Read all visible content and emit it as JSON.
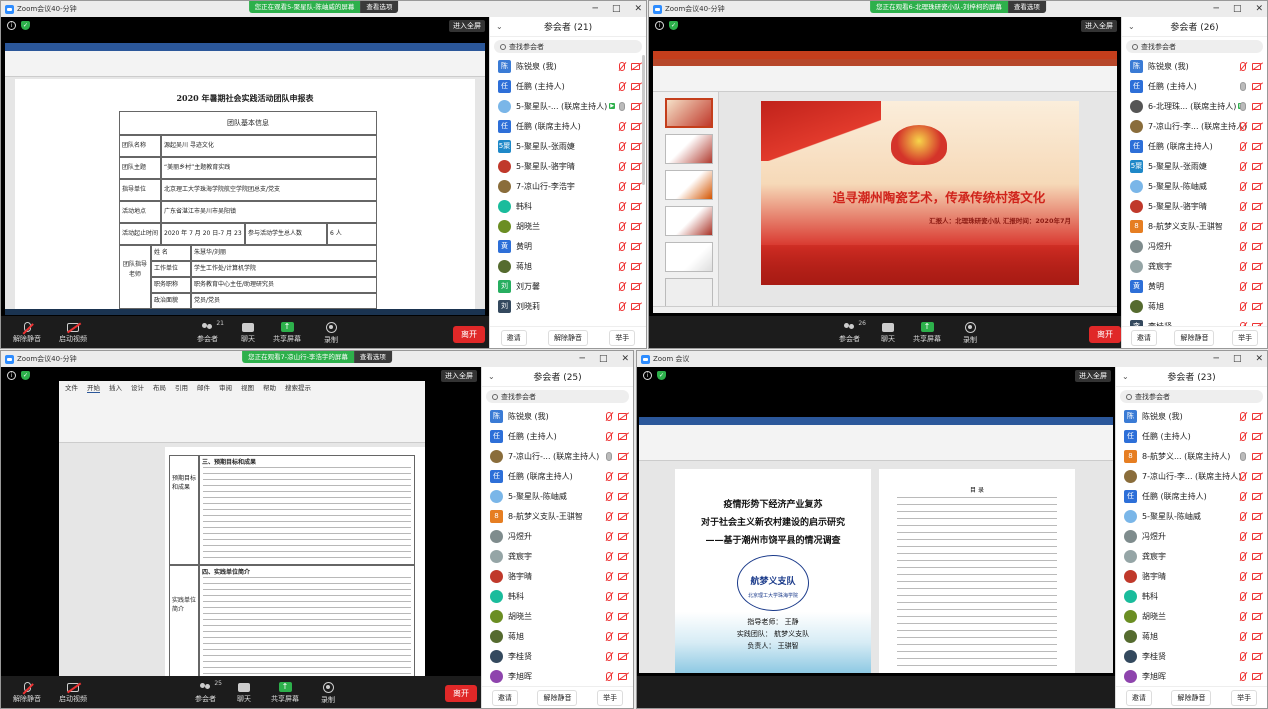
{
  "windows": [
    {
      "title": "Zoom会议40-分钟",
      "sharing_text": "您正在观看5-聚星队-陈岫威的屏幕",
      "view_options": "查看选项",
      "fullscreen": "进入全屏",
      "toolbar": {
        "unmute": "解除静音",
        "video": "启动视频",
        "participants": "参会者",
        "participants_count": "21",
        "chat": "聊天",
        "share": "共享屏幕",
        "record": "录制",
        "end": "离开"
      },
      "panel": {
        "title": "参会者 (21)",
        "search": "查找参会者",
        "footer": [
          "邀请",
          "解除静音",
          "举手"
        ],
        "participants": [
          {
            "name": "陈锐泉 (我)",
            "avatar": "陈",
            "color": "#3a7bd5",
            "mic": "off"
          },
          {
            "name": "任鹏 (主持人)",
            "avatar": "任",
            "color": "#2d6fd8",
            "mic": "off"
          },
          {
            "name": "5-聚星队-... (联席主持人)",
            "avatar": "",
            "color": "#7ab6e8",
            "mic": "on",
            "badge": "▶"
          },
          {
            "name": "任鹏 (联席主持人)",
            "avatar": "任",
            "color": "#2d6fd8",
            "mic": "off"
          },
          {
            "name": "5-聚星队-张雨婕",
            "avatar": "5聚",
            "color": "#1e88c8",
            "mic": "off"
          },
          {
            "name": "5-聚星队-骆宇晴",
            "avatar": "",
            "color": "#c0392b",
            "mic": "off"
          },
          {
            "name": "7-凉山行-李浩宇",
            "avatar": "",
            "color": "#8a6d3b",
            "mic": "off"
          },
          {
            "name": "韩科",
            "avatar": "",
            "color": "#1abc9c",
            "mic": "off"
          },
          {
            "name": "胡晓兰",
            "avatar": "",
            "color": "#6b8e23",
            "mic": "off"
          },
          {
            "name": "黄明",
            "avatar": "黄",
            "color": "#2d6fd8",
            "mic": "off"
          },
          {
            "name": "蒋旭",
            "avatar": "",
            "color": "#556b2f",
            "mic": "off"
          },
          {
            "name": "刘万馨",
            "avatar": "刘",
            "color": "#27ae60",
            "mic": "off"
          },
          {
            "name": "刘晓莉",
            "avatar": "刘",
            "color": "#34495e",
            "mic": "off"
          }
        ]
      },
      "doc": {
        "heading": "2020 年暑期社会实践活动团队申报表",
        "table_title": "团队基本信息",
        "rows": [
          [
            "团队名称",
            "源起吴川 寻迹文化"
          ],
          [
            "团队主题",
            "“美丽乡村”主题教育实践"
          ],
          [
            "指导单位",
            "北京理工大学珠海学院航空学院团总支/党支"
          ],
          [
            "活动地点",
            "广东省湛江市吴川市吴阳镇"
          ],
          [
            "活动起止时间",
            "2020 年 7 月 20 日-7 月 23 日",
            "参与活动学生总人数",
            "6 人"
          ]
        ],
        "sub_rows": [
          [
            "姓 名",
            "朱慧华/刘丽"
          ],
          [
            "工作单位",
            "学生工作处/计算机学院"
          ],
          [
            "职务职称",
            "职务教育中心主任/助理研究员"
          ],
          [
            "政治面貌",
            "党员/党员"
          ]
        ],
        "side_label": "团队指导老师"
      }
    },
    {
      "title": "Zoom会议40-分钟",
      "sharing_text": "您正在观看6-北理珠研瓷小队-刘梓柯的屏幕",
      "view_options": "查看选项",
      "fullscreen": "进入全屏",
      "toolbar": {
        "unmute": "解除静音",
        "video": "启动视频",
        "participants": "参会者",
        "participants_count": "26",
        "chat": "聊天",
        "share": "共享屏幕",
        "record": "录制",
        "end": "离开"
      },
      "panel": {
        "title": "参会者 (26)",
        "search": "查找参会者",
        "footer": [
          "邀请",
          "解除静音",
          "举手"
        ],
        "participants": [
          {
            "name": "陈锐泉 (我)",
            "avatar": "陈",
            "color": "#3a7bd5",
            "mic": "off"
          },
          {
            "name": "任鹏 (主持人)",
            "avatar": "任",
            "color": "#2d6fd8",
            "mic": "on"
          },
          {
            "name": "6-北理珠... (联席主持人)",
            "avatar": "",
            "color": "#555",
            "mic": "on",
            "badge": "▶"
          },
          {
            "name": "7-凉山行-李... (联席主持人)",
            "avatar": "",
            "color": "#8a6d3b",
            "mic": "off"
          },
          {
            "name": "任鹏 (联席主持人)",
            "avatar": "任",
            "color": "#2d6fd8",
            "mic": "off"
          },
          {
            "name": "5-聚星队-张雨婕",
            "avatar": "5聚",
            "color": "#1e88c8",
            "mic": "off"
          },
          {
            "name": "5-聚星队-陈岫威",
            "avatar": "",
            "color": "#7ab6e8",
            "mic": "off"
          },
          {
            "name": "5-聚星队-骆宇晴",
            "avatar": "",
            "color": "#c0392b",
            "mic": "off"
          },
          {
            "name": "8-航梦义支队-王骐智",
            "avatar": "8",
            "color": "#e67e22",
            "mic": "off"
          },
          {
            "name": "冯煜升",
            "avatar": "",
            "color": "#7f8c8d",
            "mic": "off"
          },
          {
            "name": "龚宸宇",
            "avatar": "",
            "color": "#95a5a6",
            "mic": "off"
          },
          {
            "name": "黄明",
            "avatar": "黄",
            "color": "#2d6fd8",
            "mic": "off"
          },
          {
            "name": "蒋旭",
            "avatar": "",
            "color": "#556b2f",
            "mic": "off"
          },
          {
            "name": "李桂贤",
            "avatar": "李",
            "color": "#34495e",
            "mic": "off"
          }
        ]
      },
      "ppt": {
        "title": "追寻潮州陶瓷艺术，传承传统村落文化",
        "subtitle": "汇报人：北理珠研瓷小队   汇报时间：2020年7月",
        "app_title": "北理珠.pptx - PowerPoint"
      }
    },
    {
      "title": "Zoom会议40-分钟",
      "sharing_text": "您正在观看7-凉山行-李浩宇的屏幕",
      "view_options": "查看选项",
      "fullscreen": "进入全屏",
      "toolbar": {
        "unmute": "解除静音",
        "video": "启动视频",
        "participants": "参会者",
        "participants_count": "25",
        "chat": "聊天",
        "share": "共享屏幕",
        "record": "录制",
        "end": "离开"
      },
      "panel": {
        "title": "参会者 (25)",
        "search": "查找参会者",
        "footer": [
          "邀请",
          "解除静音",
          "举手"
        ],
        "participants": [
          {
            "name": "陈锐泉 (我)",
            "avatar": "陈",
            "color": "#3a7bd5",
            "mic": "off"
          },
          {
            "name": "任鹏 (主持人)",
            "avatar": "任",
            "color": "#2d6fd8",
            "mic": "off"
          },
          {
            "name": "7-凉山行-... (联席主持人)",
            "avatar": "",
            "color": "#8a6d3b",
            "mic": "on"
          },
          {
            "name": "任鹏 (联席主持人)",
            "avatar": "任",
            "color": "#2d6fd8",
            "mic": "off"
          },
          {
            "name": "5-聚星队-陈岫威",
            "avatar": "",
            "color": "#7ab6e8",
            "mic": "off"
          },
          {
            "name": "8-航梦义支队-王骐智",
            "avatar": "8",
            "color": "#e67e22",
            "mic": "off"
          },
          {
            "name": "冯煜升",
            "avatar": "",
            "color": "#7f8c8d",
            "mic": "off"
          },
          {
            "name": "龚宸宇",
            "avatar": "",
            "color": "#95a5a6",
            "mic": "off"
          },
          {
            "name": "骆宇晴",
            "avatar": "",
            "color": "#c0392b",
            "mic": "off"
          },
          {
            "name": "韩科",
            "avatar": "",
            "color": "#1abc9c",
            "mic": "off"
          },
          {
            "name": "胡晓兰",
            "avatar": "",
            "color": "#6b8e23",
            "mic": "off"
          },
          {
            "name": "蒋旭",
            "avatar": "",
            "color": "#556b2f",
            "mic": "off"
          },
          {
            "name": "李桂贤",
            "avatar": "",
            "color": "#34495e",
            "mic": "off"
          },
          {
            "name": "李旭晖",
            "avatar": "",
            "color": "#8e44ad",
            "mic": "off"
          }
        ]
      },
      "doc": {
        "menu": [
          "文件",
          "开始",
          "插入",
          "设计",
          "布局",
          "引用",
          "邮件",
          "审阅",
          "视图",
          "帮助",
          "搜索提示"
        ],
        "section1": "三、预期目标和成果",
        "label1": "预期目标和成果",
        "section2": "四、实践单位简介",
        "label2": "实践单位简介"
      }
    },
    {
      "title": "Zoom 会议",
      "sharing_text": "",
      "view_options": "",
      "fullscreen": "进入全屏",
      "toolbar": {
        "unmute": "解除静音",
        "video": "启动视频",
        "participants": "参会者",
        "participants_count": "23",
        "chat": "聊天",
        "share": "共享屏幕",
        "record": "录制",
        "end": "离开"
      },
      "panel": {
        "title": "参会者 (23)",
        "search": "查找参会者",
        "footer": [
          "邀请",
          "解除静音",
          "举手"
        ],
        "participants": [
          {
            "name": "陈锐泉 (我)",
            "avatar": "陈",
            "color": "#3a7bd5",
            "mic": "off"
          },
          {
            "name": "任鹏 (主持人)",
            "avatar": "任",
            "color": "#2d6fd8",
            "mic": "off"
          },
          {
            "name": "8-航梦义... (联席主持人)",
            "avatar": "8",
            "color": "#e67e22",
            "mic": "on"
          },
          {
            "name": "7-凉山行-李... (联席主持人)",
            "avatar": "",
            "color": "#8a6d3b",
            "mic": "off"
          },
          {
            "name": "任鹏 (联席主持人)",
            "avatar": "任",
            "color": "#2d6fd8",
            "mic": "off"
          },
          {
            "name": "5-聚星队-陈岫威",
            "avatar": "",
            "color": "#7ab6e8",
            "mic": "off"
          },
          {
            "name": "冯煜升",
            "avatar": "",
            "color": "#7f8c8d",
            "mic": "off"
          },
          {
            "name": "龚宸宇",
            "avatar": "",
            "color": "#95a5a6",
            "mic": "off"
          },
          {
            "name": "骆宇晴",
            "avatar": "",
            "color": "#c0392b",
            "mic": "off"
          },
          {
            "name": "韩科",
            "avatar": "",
            "color": "#1abc9c",
            "mic": "off"
          },
          {
            "name": "胡晓兰",
            "avatar": "",
            "color": "#6b8e23",
            "mic": "off"
          },
          {
            "name": "蒋旭",
            "avatar": "",
            "color": "#556b2f",
            "mic": "off"
          },
          {
            "name": "李桂贤",
            "avatar": "",
            "color": "#34495e",
            "mic": "off"
          },
          {
            "name": "李旭晖",
            "avatar": "",
            "color": "#8e44ad",
            "mic": "off"
          }
        ]
      },
      "cover": {
        "line1": "疫情形势下经济产业复苏",
        "line2": "对于社会主义新农村建设的启示研究",
        "line3": "——基于潮州市饶平县的情况调查",
        "team_logo": "航梦义支队",
        "school": "北京理工大学珠海学院",
        "advisor": "指导老师： 王静",
        "team": "实践团队： 航梦义支队",
        "leader": "负责人： 王骐智",
        "toc_title": "目 录"
      }
    }
  ]
}
